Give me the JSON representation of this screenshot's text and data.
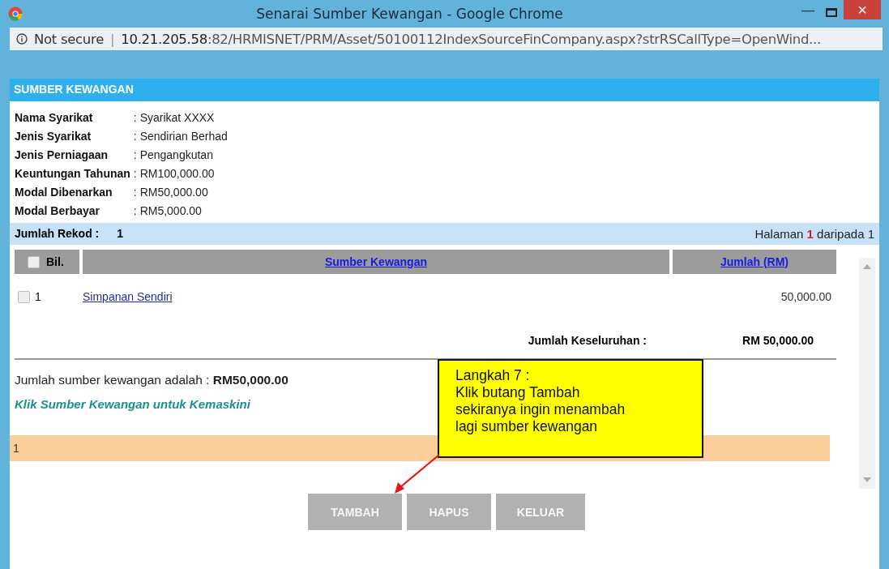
{
  "window": {
    "title": "Senarai Sumber Kewangan - Google Chrome",
    "minimize": "—",
    "close": "×"
  },
  "address_bar": {
    "security": "Not secure",
    "separator": "|",
    "url_host": "10.21.205.58",
    "url_rest": ":82/HRMISNET/PRM/Asset/50100112IndexSourceFinCompany.aspx?strRSCallType=OpenWind..."
  },
  "section_title": "SUMBER KEWANGAN",
  "details": [
    {
      "label": "Nama Syarikat",
      "colon": ":",
      "value": "Syarikat XXXX"
    },
    {
      "label": "Jenis Syarikat",
      "colon": ":",
      "value": "Sendirian Berhad"
    },
    {
      "label": "Jenis Perniagaan",
      "colon": ":",
      "value": "Pengangkutan"
    },
    {
      "label": "Keuntungan Tahunan",
      "colon": ":",
      "value": "RM100,000.00"
    },
    {
      "label": "Modal Dibenarkan",
      "colon": ":",
      "value": "RM50,000.00"
    },
    {
      "label": "Modal Berbayar",
      "colon": ":",
      "value": "RM5,000.00"
    }
  ],
  "record_bar": {
    "label": "Jumlah Rekod :",
    "count": "1",
    "page_prefix": "Halaman",
    "page_current": "1",
    "page_suffix": "daripada 1"
  },
  "table": {
    "select_all_checked": false,
    "columns": [
      "Bil.",
      "Sumber Kewangan",
      "Jumlah (RM)"
    ],
    "rows": [
      {
        "checked": false,
        "bil": "1",
        "source": "Simpanan Sendiri",
        "amount": "50,000.00"
      }
    ],
    "total_label": "Jumlah Keseluruhan :",
    "total_value": "RM 50,000.00"
  },
  "summary": "Jumlah sumber kewangan adalah : **RM50,000.00**",
  "hint": "Klik Sumber Kewangan untuk Kemaskini",
  "pager": "1",
  "buttons": [
    "TAMBAH",
    "HAPUS",
    "KELUAR"
  ],
  "callout": {
    "lines": [
      "Langkah 7 :",
      "Klik butang Tambah",
      "sekiranya ingin menambah",
      "lagi sumber kewangan"
    ]
  }
}
